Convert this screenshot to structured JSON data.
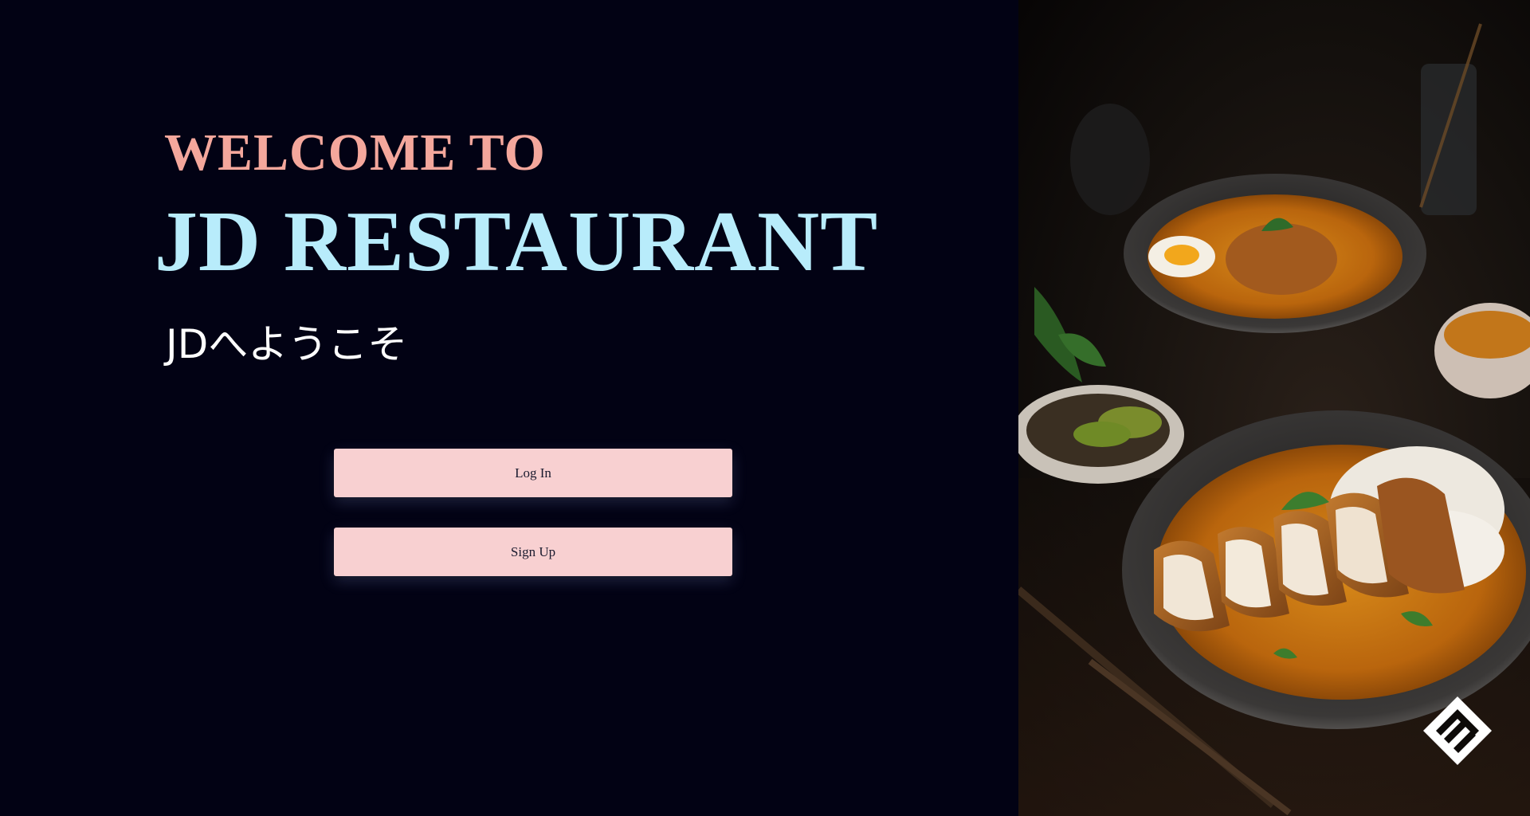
{
  "hero": {
    "welcome_to": "WELCOME TO",
    "restaurant_name": "JD RESTAURANT",
    "japanese_welcome": "JDへようこそ"
  },
  "actions": {
    "login_label": "Log In",
    "signup_label": "Sign Up"
  },
  "colors": {
    "background": "#020214",
    "welcome_to": "#f4a79c",
    "restaurant_name": "#b8ecfb",
    "japanese_welcome": "#ffffff",
    "button_bg": "#f8d0d1",
    "button_text": "#1a1a2e"
  },
  "icons": {
    "brand_logo": "diamond-logo-icon"
  }
}
